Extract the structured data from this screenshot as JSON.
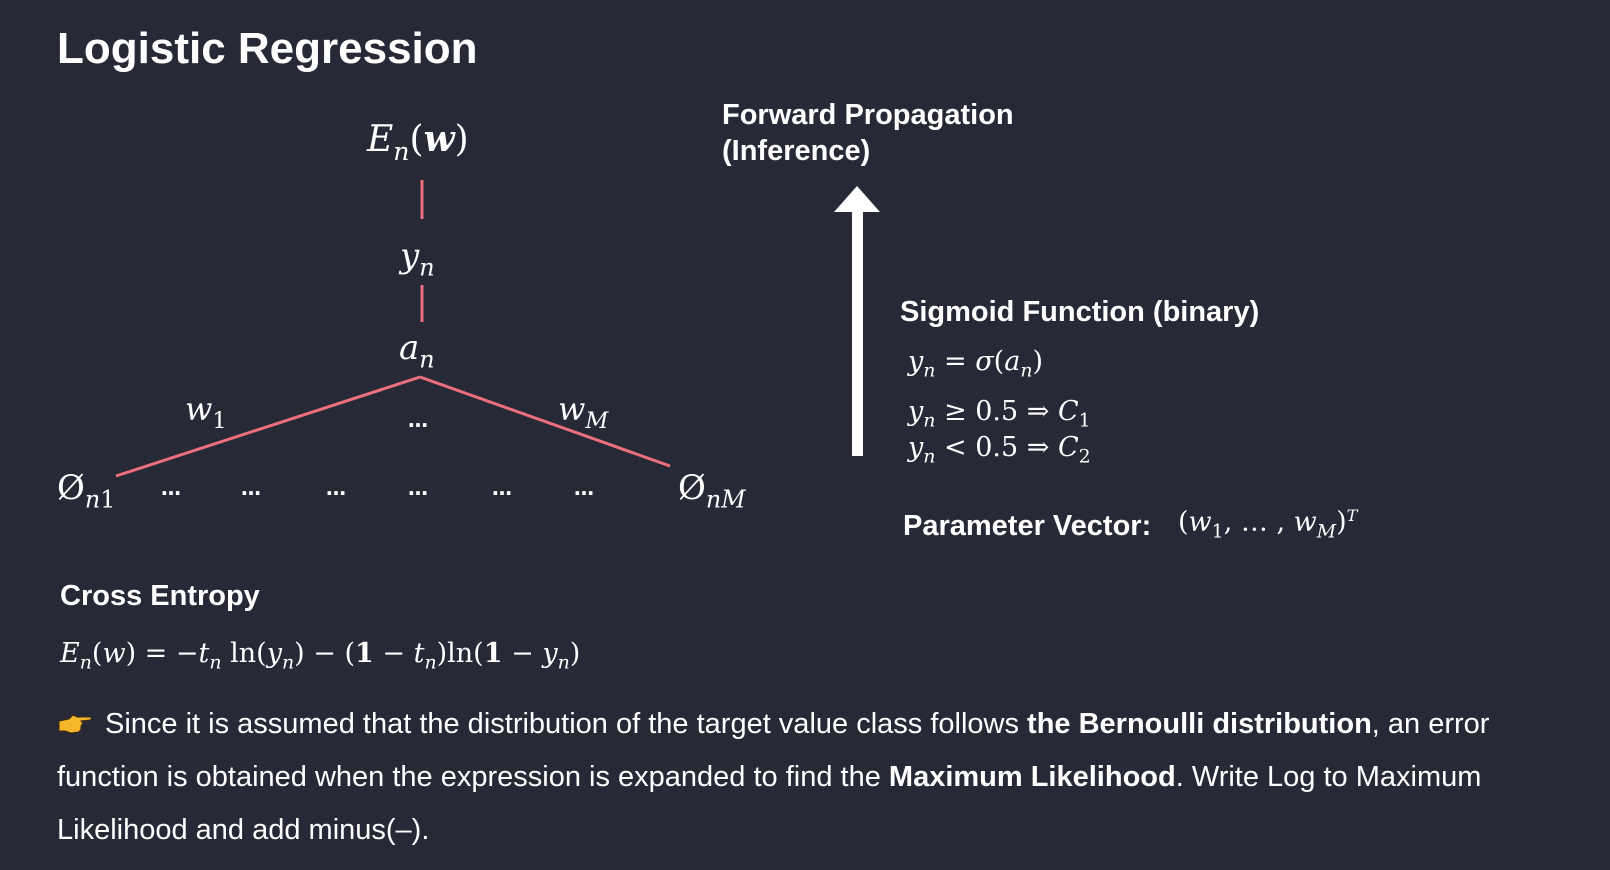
{
  "title": "Logistic Regression",
  "diagram": {
    "error": "E_n(w)",
    "output": "y_n",
    "activation": "a_n",
    "weight_first": "w_1",
    "weight_last": "w_M",
    "input_first": "Ø_n1",
    "input_last": "Ø_nM",
    "ellipsis": "…"
  },
  "forward": {
    "label_line1": "Forward Propagation",
    "label_line2": "(Inference)"
  },
  "sigmoid": {
    "heading": "Sigmoid Function (binary)",
    "eq1": "y_n = σ(a_n)",
    "eq2": "y_n ≥ 0.5 ⇒ C_1",
    "eq3": "y_n < 0.5 ⇒ C_2"
  },
  "parameter": {
    "label": "Parameter Vector:",
    "value": "(w_1, …, w_M)^T"
  },
  "cross_entropy": {
    "heading": "Cross Entropy",
    "formula": "E_n(w) = −t_n ln(y_n) − (1 − t_n)ln(1 − y_n)"
  },
  "explanation": {
    "icon": "pointing-hand-icon",
    "text1": "Since it is assumed that the distribution of the target value class follows ",
    "bold1": "the Bernoulli distribution",
    "text2": ", an error function is obtained when the expression is expanded to find the ",
    "bold2": "Maximum Likelihood",
    "text3": ". Write Log to Maximum Likelihood and add minus(–)."
  },
  "colors": {
    "background": "#272a36",
    "edge": "#ec6f7d",
    "text": "#ffffff",
    "hand": "#f5b62c"
  }
}
